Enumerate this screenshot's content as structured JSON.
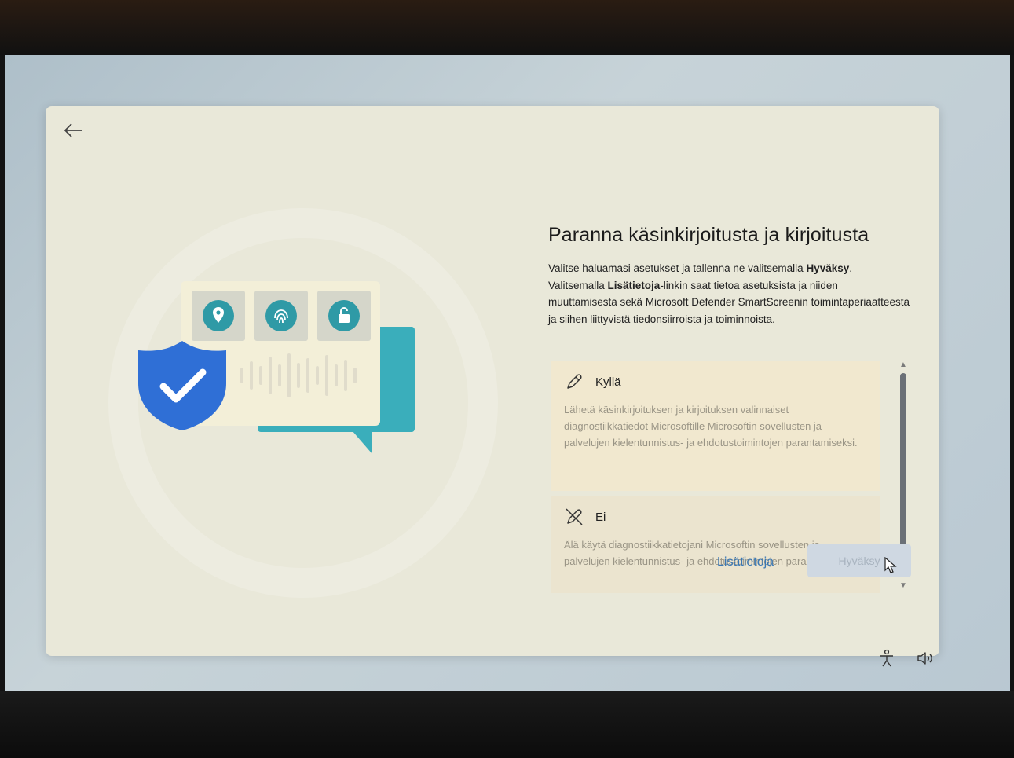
{
  "navigation": {
    "back_icon": "arrow-left-icon"
  },
  "header": {
    "title": "Paranna käsinkirjoitusta ja kirjoitusta"
  },
  "description": {
    "line1_prefix": "Valitse haluamasi asetukset ja tallenna ne valitsemalla ",
    "line1_bold": "Hyväksy",
    "line1_suffix": ".",
    "line2_prefix": "Valitsemalla ",
    "line2_bold": "Lisätietoja",
    "line2_suffix": "-linkin saat tietoa asetuksista ja niiden muuttamisesta sekä Microsoft Defender SmartScreenin toimintaperiaatteesta ja siihen liittyvistä tiedonsiirroista ja toiminnoista."
  },
  "options": [
    {
      "icon": "pen-icon",
      "label": "Kyllä",
      "text": "Lähetä käsinkirjoituksen ja kirjoituksen valinnaiset diagnostiikkatiedot Microsoftille Microsoftin sovellusten ja palvelujen kielentunnistus- ja ehdotustoimintojen parantamiseksi.",
      "selected": true
    },
    {
      "icon": "pen-off-icon",
      "label": "Ei",
      "text": "Älä käytä diagnostiikkatietojani Microsoftin sovellusten ja palvelujen kielentunnistus- ja ehdotustoimintojen parantamiseksi.",
      "selected": false
    }
  ],
  "footer": {
    "more_info_link": "Lisätietoja",
    "accept_button": "Hyväksy"
  },
  "illustration": {
    "tile_icons": [
      "location-pin-icon",
      "fingerprint-icon",
      "unlock-icon"
    ],
    "shield_icon": "shield-check-icon"
  },
  "system_tray": {
    "icons": [
      "accessibility-icon",
      "volume-icon"
    ]
  },
  "colors": {
    "dialog_bg": "#e9e8d9",
    "accent": "#3a78b5",
    "teal": "#3aaebb",
    "shield_blue": "#2f6fd6"
  }
}
